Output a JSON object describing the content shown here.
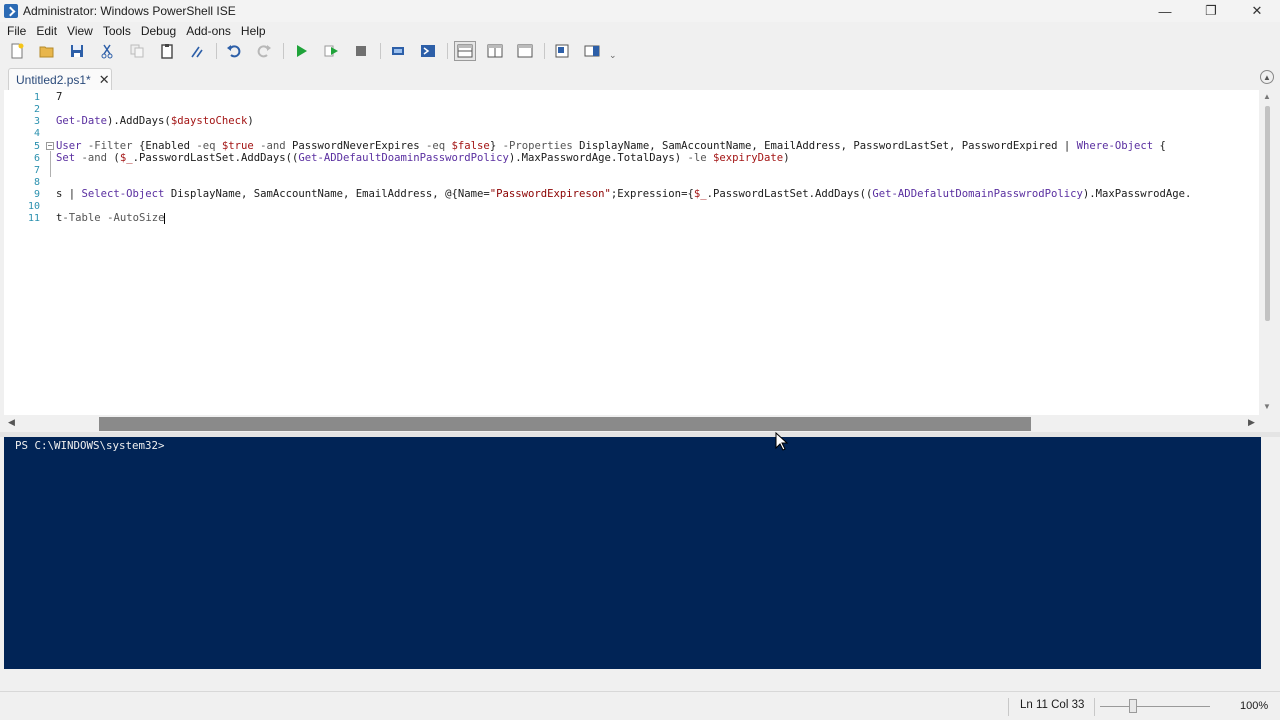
{
  "window": {
    "title": "Administrator: Windows PowerShell ISE",
    "controls": {
      "minimize": "—",
      "restore": "❐",
      "close": "✕"
    }
  },
  "menu": [
    "File",
    "Edit",
    "View",
    "Tools",
    "Debug",
    "Add-ons",
    "Help"
  ],
  "toolbar": {
    "buttons": [
      "new-script",
      "open",
      "save",
      "cut",
      "copy",
      "paste",
      "clear",
      "undo",
      "redo",
      "run-script",
      "run-selection",
      "stop",
      "new-remote-tab",
      "start-powershell",
      "show-script-pane-top",
      "show-script-pane-right",
      "show-script-pane-maximized",
      "show-command-window",
      "show-command-addon"
    ]
  },
  "tab": {
    "label": "Untitled2.ps1*",
    "close": "✕"
  },
  "editor": {
    "lines": [
      {
        "num": "1",
        "text": "7"
      },
      {
        "num": "2",
        "text": ""
      },
      {
        "num": "3",
        "text": "Get-Date).AddDays($daystoCheck)"
      },
      {
        "num": "4",
        "text": ""
      },
      {
        "num": "5",
        "text": "User -Filter {Enabled -eq $true -and PasswordNeverExpires -eq $false} -Properties DisplayName, SamAccountName, EmailAddress, PasswordLastSet, PasswordExpired | Where-Object {"
      },
      {
        "num": "6",
        "text": "Set -and ($_.PasswordLastSet.AddDays((Get-ADDefaultDoaminPasswordPolicy).MaxPasswordAge.TotalDays) -le $expiryDate)"
      },
      {
        "num": "7",
        "text": ""
      },
      {
        "num": "8",
        "text": ""
      },
      {
        "num": "9",
        "text": "s | Select-Object DisplayName, SamAccountName, EmailAddress, @{Name=\"PasswordExpireson\";Expression={$_.PasswordLastSet.AddDays((Get-ADDefalutDomainPasswrodPolicy).MaxPasswrodAge."
      },
      {
        "num": "10",
        "text": ""
      },
      {
        "num": "11",
        "text": "t-Table -AutoSize"
      }
    ]
  },
  "console": {
    "prompt": "PS C:\\WINDOWS\\system32>"
  },
  "status": {
    "position": "Ln 11  Col 33",
    "zoom": "100%",
    "zoom_level": 0.3
  },
  "colors": {
    "console_bg": "#012456",
    "line_number": "#2b91af"
  }
}
